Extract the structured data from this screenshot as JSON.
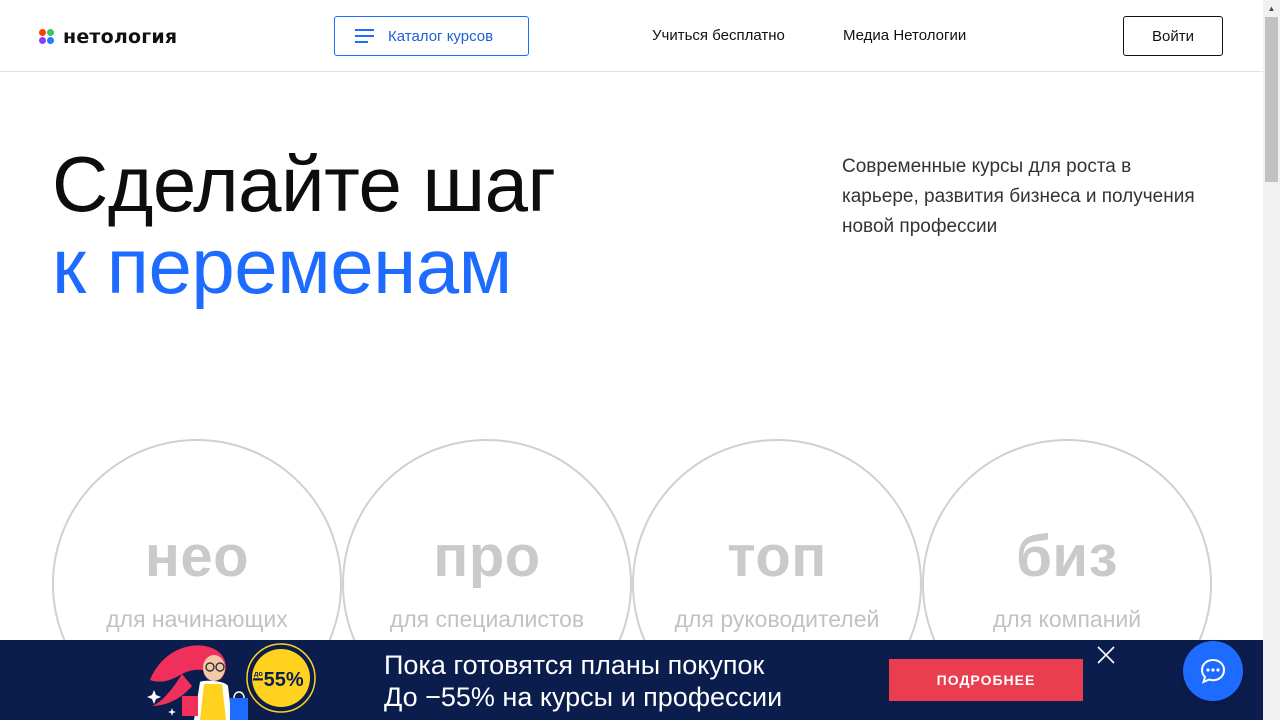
{
  "header": {
    "logo_text": "нетология",
    "catalog_label": "Каталог курсов",
    "nav": [
      "Учиться бесплатно",
      "Медиа Нетологии"
    ],
    "login_label": "Войти"
  },
  "hero": {
    "title_line1": "Сделайте шаг",
    "title_line2": "к переменам",
    "description": "Современные курсы для роста в карьере, развития бизнеса и получения новой профессии"
  },
  "levels": [
    {
      "title": "нео",
      "subtitle": "для начинающих"
    },
    {
      "title": "про",
      "subtitle": "для специалистов"
    },
    {
      "title": "топ",
      "subtitle": "для руководителей"
    },
    {
      "title": "биз",
      "subtitle": "для компаний"
    }
  ],
  "banner": {
    "badge_prefix": "до",
    "badge_value": "−55%",
    "line1": "Пока готовятся планы покупок",
    "line2": "До −55% на курсы и профессии",
    "button_label": "ПОДРОБНЕЕ"
  },
  "icons": {
    "close": "close-icon",
    "chat": "chat-icon",
    "menu": "menu-icon"
  },
  "colors": {
    "accent": "#1e6bff",
    "banner_bg": "#0b1d4d",
    "banner_button": "#ea3d4d",
    "badge": "#ffd21f"
  }
}
